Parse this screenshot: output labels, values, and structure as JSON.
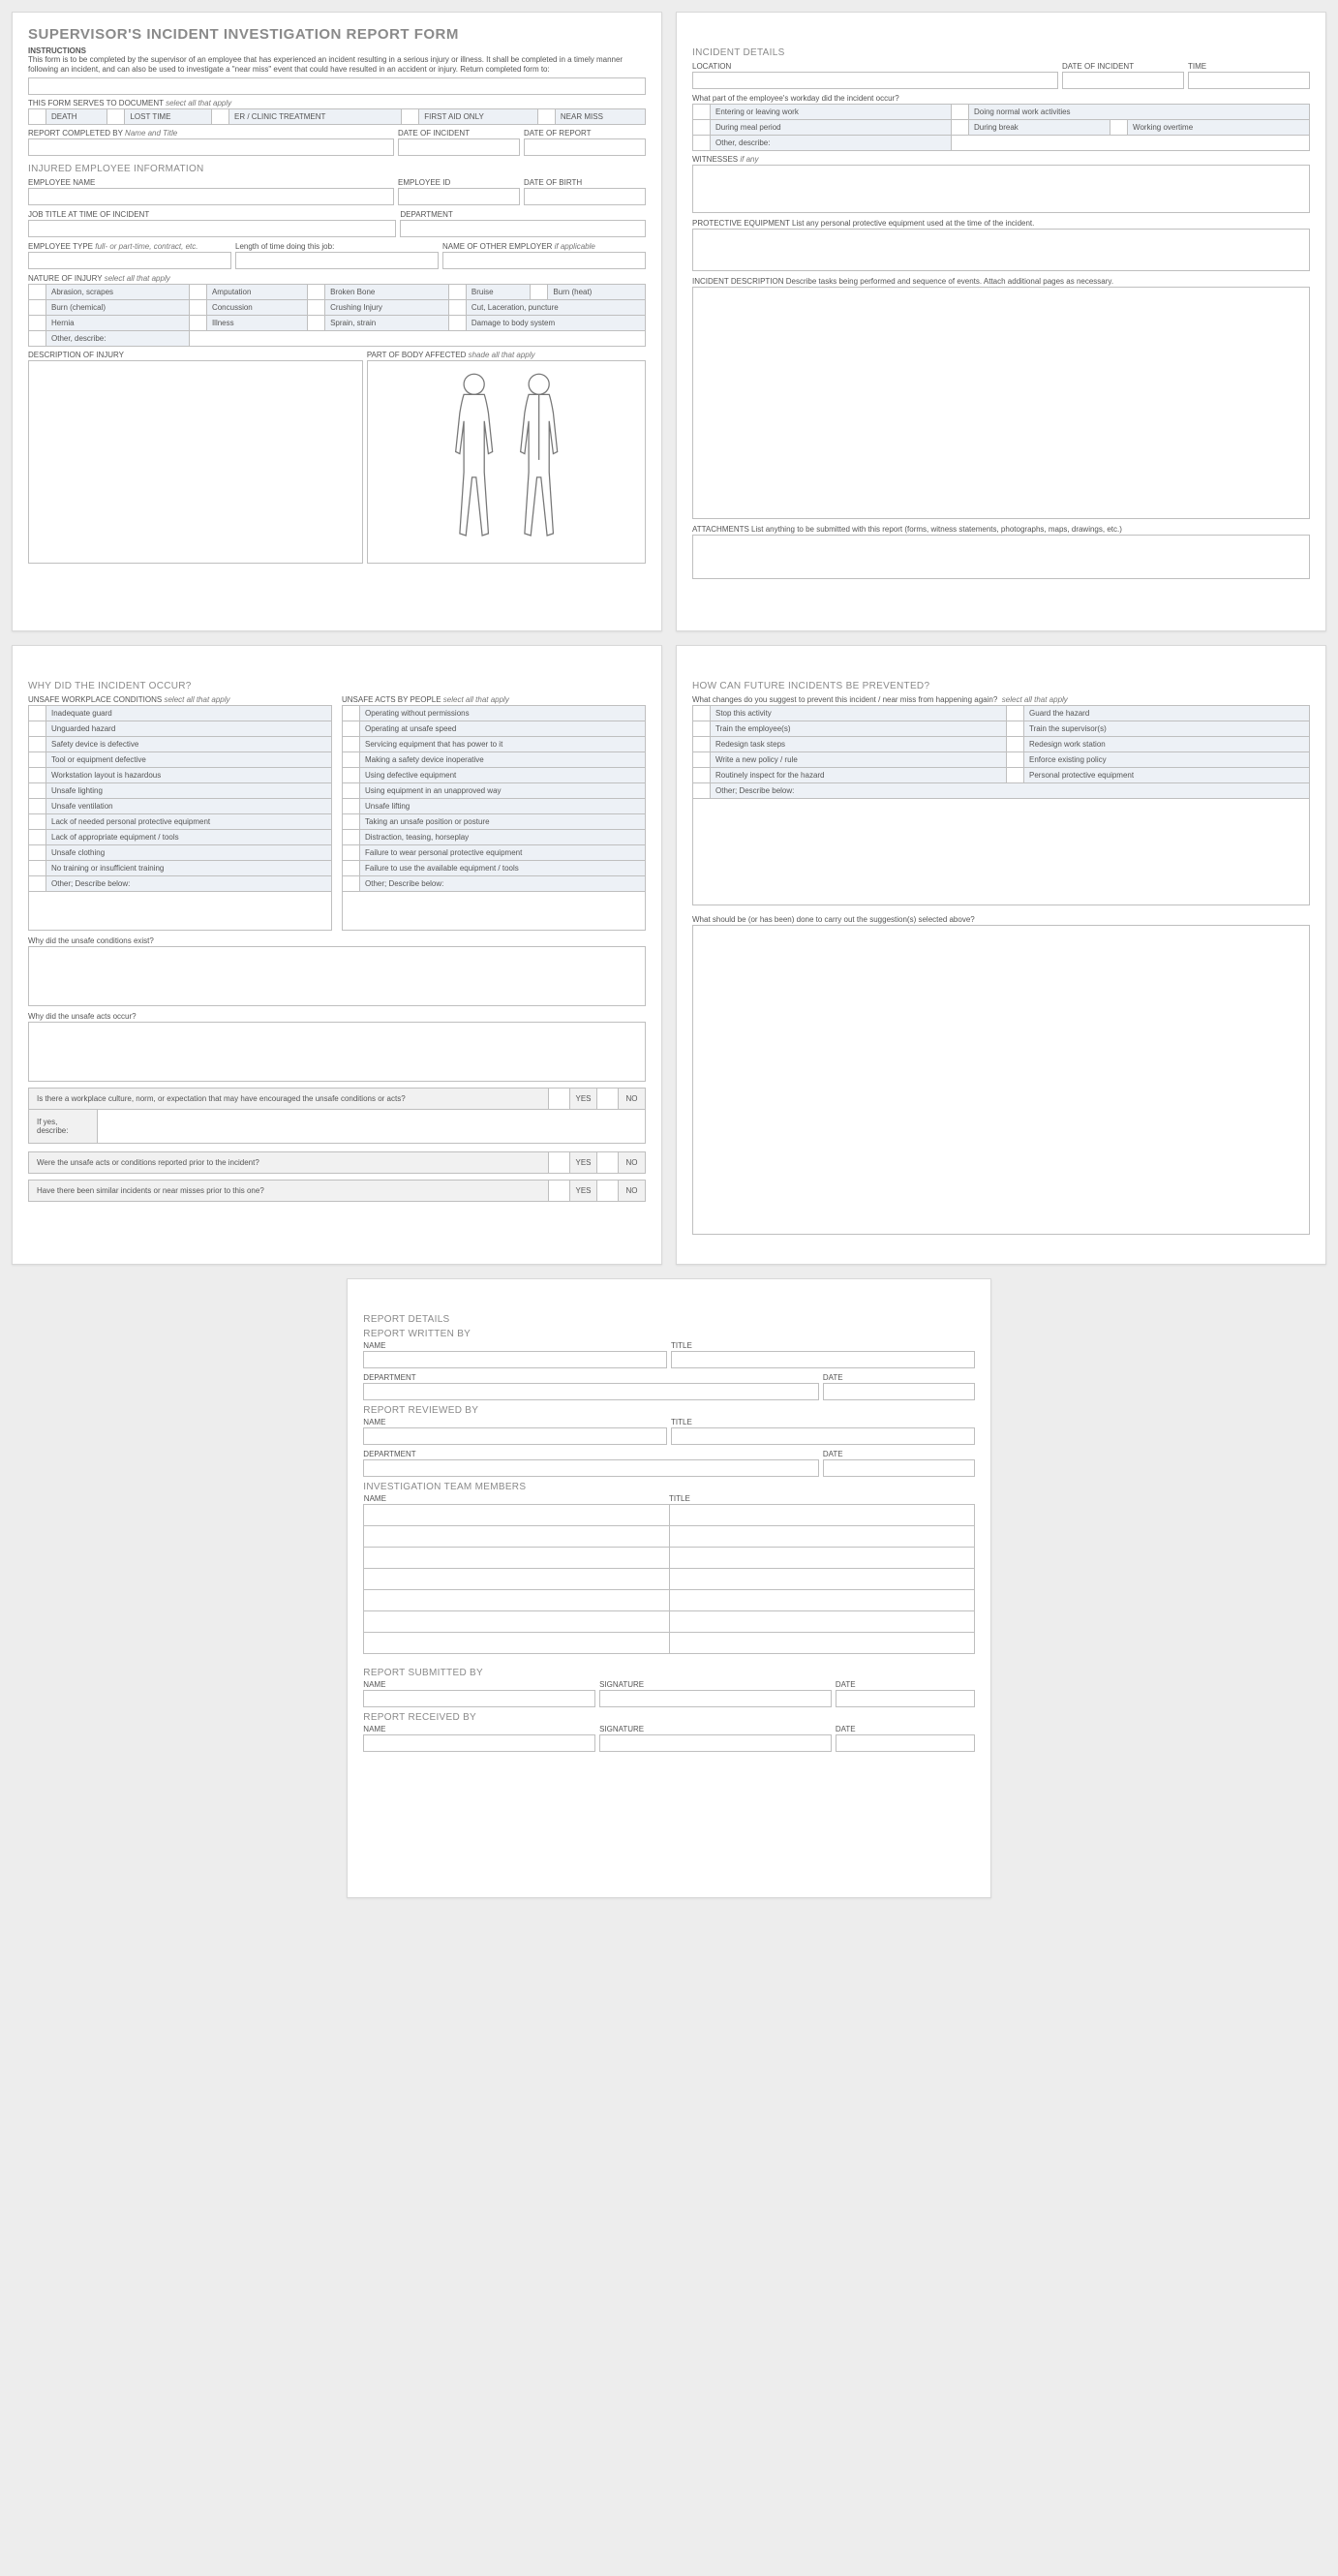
{
  "title": "SUPERVISOR'S INCIDENT INVESTIGATION REPORT FORM",
  "instructions": {
    "heading": "INSTRUCTIONS",
    "body": "This form is to be completed by the supervisor of an employee that has experienced an incident resulting in a serious injury or illness. It shall be completed in a timely manner following an incident, and can also be used to investigate a \"near miss\" event that could have resulted in an accident or injury. Return completed form to:"
  },
  "docServes": {
    "label": "THIS FORM SERVES TO DOCUMENT",
    "sub": "select all that apply",
    "opts": [
      "DEATH",
      "LOST TIME",
      "ER / CLINIC TREATMENT",
      "FIRST AID ONLY",
      "NEAR MISS"
    ]
  },
  "reportBy": {
    "label": "REPORT COMPLETED BY",
    "sub": "Name and Title"
  },
  "dateOfIncident": "DATE OF INCIDENT",
  "dateOfReport": "DATE OF REPORT",
  "injEmp": {
    "heading": "INJURED EMPLOYEE INFORMATION",
    "name": "EMPLOYEE NAME",
    "id": "EMPLOYEE ID",
    "dob": "DATE OF BIRTH",
    "jobTitle": "JOB TITLE AT TIME OF INCIDENT",
    "dept": "DEPARTMENT",
    "empType": {
      "label": "EMPLOYEE TYPE",
      "sub": "full- or part-time, contract, etc."
    },
    "lengthJob": "Length of time doing this job:",
    "otherEmployer": {
      "label": "NAME OF OTHER EMPLOYER",
      "sub": "if applicable"
    }
  },
  "natureInjury": {
    "label": "NATURE OF INJURY",
    "sub": "select all that apply",
    "rows": [
      [
        "Abrasion, scrapes",
        "Amputation",
        "Broken Bone",
        "Bruise",
        "Burn (heat)"
      ],
      [
        "Burn (chemical)",
        "Concussion",
        "Crushing Injury",
        "Cut, Laceration, puncture",
        ""
      ],
      [
        "Hernia",
        "Illness",
        "Sprain, strain",
        "Damage to body system",
        ""
      ]
    ],
    "other": "Other, describe:"
  },
  "descInjury": "DESCRIPTION OF INJURY",
  "bodyPart": {
    "label": "PART OF BODY AFFECTED",
    "sub": "shade all that apply"
  },
  "incDetails": {
    "heading": "INCIDENT DETAILS",
    "location": "LOCATION",
    "doi": "DATE OF INCIDENT",
    "time": "TIME",
    "workdayQ": "What part of the employee's workday did the incident occur?",
    "workdayOpts": [
      [
        "Entering or leaving work",
        "Doing normal work activities"
      ],
      [
        "During meal period",
        "During break",
        "Working overtime"
      ]
    ],
    "other": "Other, describe:",
    "witnesses": {
      "label": "WITNESSES",
      "sub": "if any"
    },
    "ppe": {
      "label": "PROTECTIVE EQUIPMENT",
      "sub": "List any personal protective equipment used at the time of the incident."
    },
    "desc": {
      "label": "INCIDENT DESCRIPTION",
      "sub": "Describe tasks being performed and sequence of events.  Attach additional pages as necessary."
    },
    "attach": {
      "label": "ATTACHMENTS",
      "sub": "List anything to be submitted with this report (forms, witness statements, photographs, maps, drawings, etc.)"
    }
  },
  "why": {
    "heading": "WHY DID THE INCIDENT OCCUR?",
    "condLabel": "UNSAFE WORKPLACE CONDITIONS",
    "sub": "select all that apply",
    "actsLabel": "UNSAFE ACTS BY PEOPLE",
    "cond": [
      "Inadequate guard",
      "Unguarded hazard",
      "Safety device is defective",
      "Tool or equipment defective",
      "Workstation layout is hazardous",
      "Unsafe lighting",
      "Unsafe ventilation",
      "Lack of needed personal protective equipment",
      "Lack of appropriate equipment / tools",
      "Unsafe clothing",
      "No training or insufficient training",
      "Other; Describe below:"
    ],
    "acts": [
      "Operating without permissions",
      "Operating at unsafe speed",
      "Servicing equipment that has power to it",
      "Making a safety device inoperative",
      "Using defective equipment",
      "Using equipment in an unapproved way",
      "Unsafe lifting",
      "Taking an unsafe position or posture",
      "Distraction, teasing, horseplay",
      "Failure to wear personal protective equipment",
      "Failure to use the available equipment / tools",
      "Other; Describe below:"
    ],
    "condExist": "Why did the unsafe conditions exist?",
    "actsOccur": "Why did the unsafe acts occur?",
    "cultureQ": "Is there a workplace culture, norm, or expectation that may have encouraged the unsafe conditions or acts?",
    "ifYes": "If yes, describe:",
    "reportedQ": "Were the unsafe acts or conditions reported prior to the incident?",
    "similarQ": "Have there been similar incidents or near misses prior to this one?",
    "YES": "YES",
    "NO": "NO"
  },
  "prevent": {
    "heading": "HOW CAN FUTURE INCIDENTS BE PREVENTED?",
    "q": "What changes do you suggest to prevent this incident / near miss from happening again?",
    "sub": "select all that apply",
    "rows": [
      [
        "Stop this activity",
        "Guard the hazard"
      ],
      [
        "Train the employee(s)",
        "Train the supervisor(s)"
      ],
      [
        "Redesign task steps",
        "Redesign work station"
      ],
      [
        "Write a new policy / rule",
        "Enforce existing policy"
      ],
      [
        "Routinely inspect for the hazard",
        "Personal protective equipment"
      ]
    ],
    "other": "Other; Describe below:",
    "carry": "What should be (or has been) done to carry out the suggestion(s) selected above?"
  },
  "reportDetails": {
    "heading": "REPORT DETAILS",
    "written": "REPORT WRITTEN BY",
    "reviewed": "REPORT REVIEWED BY",
    "team": "INVESTIGATION TEAM MEMBERS",
    "submitted": "REPORT SUBMITTED BY",
    "received": "REPORT RECEIVED BY",
    "name": "NAME",
    "title": "TITLE",
    "dept": "DEPARTMENT",
    "date": "DATE",
    "sig": "SIGNATURE"
  }
}
